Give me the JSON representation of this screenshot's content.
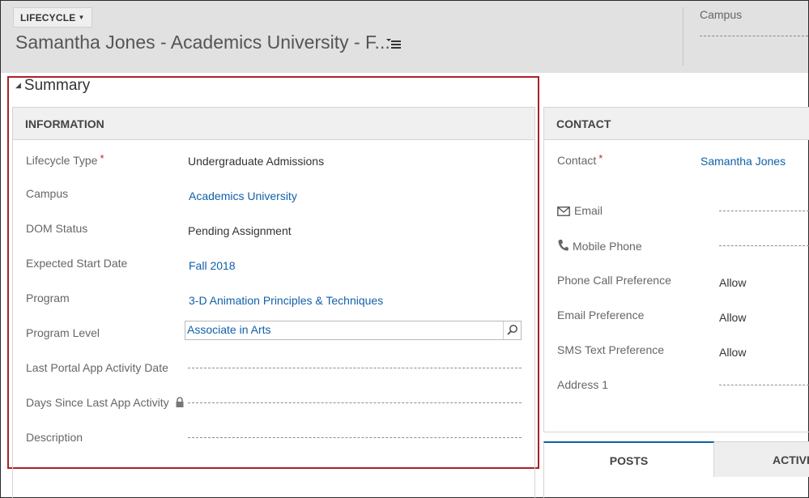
{
  "header": {
    "form_selector": "LIFECYCLE",
    "title": "Samantha Jones - Academics University - F...",
    "campus_label": "Campus"
  },
  "summary": {
    "section_title": "Summary",
    "information": {
      "heading": "INFORMATION",
      "fields": [
        {
          "label": "Lifecycle Type",
          "required": "*",
          "value": "Undergraduate Admissions"
        },
        {
          "label": "Campus",
          "value": "Academics University"
        },
        {
          "label": "DOM Status",
          "value": "Pending Assignment"
        },
        {
          "label": "Expected Start Date",
          "value": "Fall 2018"
        },
        {
          "label": "Program",
          "value": "3-D Animation Principles & Techniques"
        },
        {
          "label": "Program Level",
          "value": "Associate in Arts"
        },
        {
          "label": "Last Portal App Activity Date",
          "value": ""
        },
        {
          "label": "Days Since Last App Activity",
          "value": ""
        },
        {
          "label": "Description",
          "value": ""
        }
      ]
    }
  },
  "contact": {
    "heading": "CONTACT",
    "fields": [
      {
        "label": "Contact",
        "required": "*",
        "value": "Samantha Jones"
      },
      {
        "label": "Email",
        "value": ""
      },
      {
        "label": "Mobile Phone",
        "value": ""
      },
      {
        "label": "Phone Call Preference",
        "value": "Allow"
      },
      {
        "label": "Email Preference",
        "value": "Allow"
      },
      {
        "label": "SMS Text Preference",
        "value": "Allow"
      },
      {
        "label": "Address 1",
        "value": ""
      }
    ]
  },
  "tabs": [
    {
      "label": "POSTS"
    },
    {
      "label": "ACTIVIT"
    }
  ],
  "colors": {
    "accent": "#1160a8",
    "highlight_border": "#a42428",
    "required": "#c0272d"
  }
}
